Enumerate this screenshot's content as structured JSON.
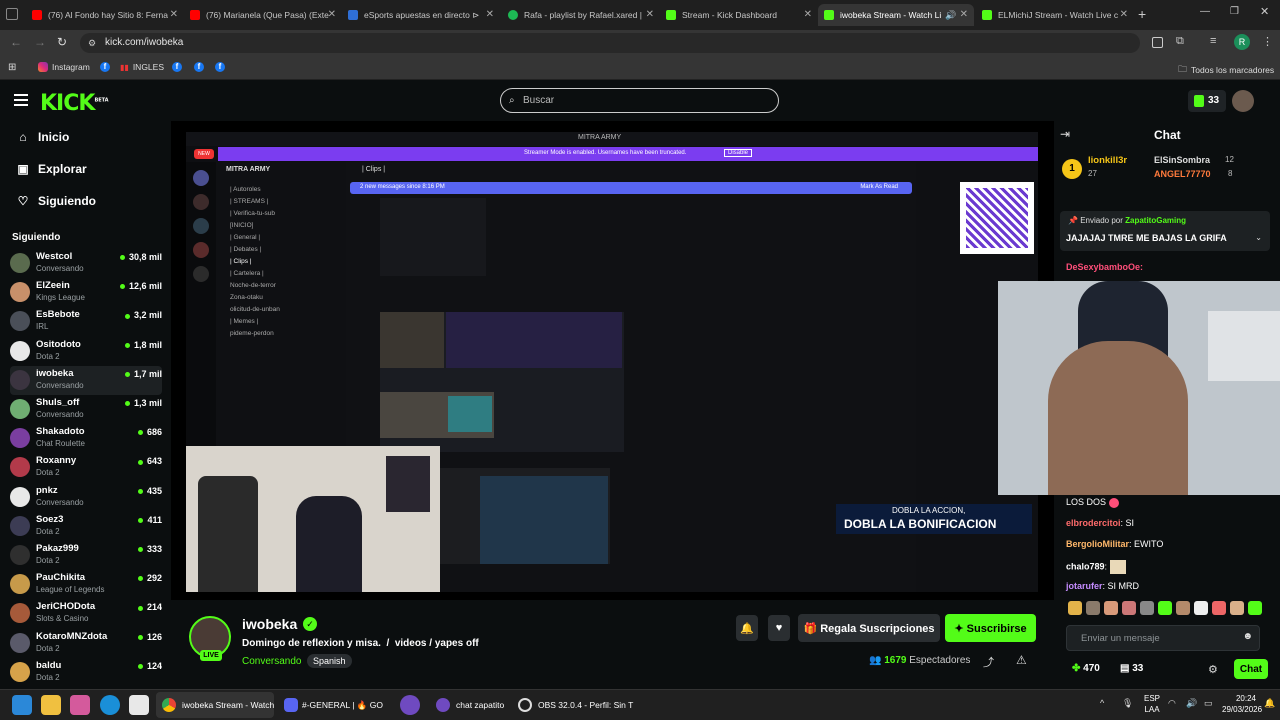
{
  "browser": {
    "tabs": [
      {
        "title": "(76) Al Fondo hay Sitio 8: Ferna",
        "color": "#ff0000"
      },
      {
        "title": "(76) Marianela (Que Pasa) (Exte",
        "color": "#ff0000"
      },
      {
        "title": "eSports apuestas en directo ⊳",
        "color": "#2f6fd6"
      },
      {
        "title": "Rafa - playlist by Rafael.xared |",
        "color": "#1db954"
      },
      {
        "title": "Stream - Kick Dashboard",
        "color": "#53fc18"
      },
      {
        "title": "iwobeka Stream - Watch Li",
        "color": "#53fc18"
      },
      {
        "title": "ELMichiJ Stream - Watch Live c",
        "color": "#53fc18"
      }
    ],
    "url": "kick.com/iwobeka",
    "bookmarks": {
      "instagram": "Instagram",
      "ingles": "INGLES",
      "all": "Todos los marcadores"
    }
  },
  "kick": {
    "logo": "KICK",
    "beta": "BETA",
    "search_placeholder": "Buscar",
    "kicks_count": "33",
    "nav": {
      "home": "Inicio",
      "browse": "Explorar",
      "following": "Siguiendo"
    },
    "following_heading": "Siguiendo",
    "following": [
      {
        "name": "Westcol",
        "game": "Conversando",
        "viewers": "30,8 mil",
        "color": "#5a6b4e"
      },
      {
        "name": "ElZeein",
        "game": "Kings League",
        "viewers": "12,6 mil",
        "color": "#c8906a"
      },
      {
        "name": "EsBebote",
        "game": "IRL",
        "viewers": "3,2 mil",
        "color": "#4a4f58"
      },
      {
        "name": "Ositodoto",
        "game": "Dota 2",
        "viewers": "1,8 mil",
        "color": "#e8e8e8"
      },
      {
        "name": "iwobeka",
        "game": "Conversando",
        "viewers": "1,7 mil",
        "color": "#3b3440"
      },
      {
        "name": "Shuls_off",
        "game": "Conversando",
        "viewers": "1,3 mil",
        "color": "#6fae72"
      },
      {
        "name": "Shakadoto",
        "game": "Chat Roulette",
        "viewers": "686",
        "color": "#7a3ea0"
      },
      {
        "name": "Roxanny",
        "game": "Dota 2",
        "viewers": "643",
        "color": "#b23a4a"
      },
      {
        "name": "pnkz",
        "game": "Conversando",
        "viewers": "435",
        "color": "#e8e8e8"
      },
      {
        "name": "Soez3",
        "game": "Dota 2",
        "viewers": "411",
        "color": "#3c3c54"
      },
      {
        "name": "Pakaz999",
        "game": "Dota 2",
        "viewers": "333",
        "color": "#2f2f2f"
      },
      {
        "name": "PauChikita",
        "game": "League of Legends",
        "viewers": "292",
        "color": "#c79a4a"
      },
      {
        "name": "JeriCHODota",
        "game": "Slots & Casino",
        "viewers": "214",
        "color": "#a65a3a"
      },
      {
        "name": "KotaroMNZdota",
        "game": "Dota 2",
        "viewers": "126",
        "color": "#5a5a6a"
      },
      {
        "name": "baldu",
        "game": "Dota 2",
        "viewers": "124",
        "color": "#d6a24a"
      }
    ],
    "stream": {
      "channel": "iwobeka",
      "live": "LIVE",
      "title": "Domingo de reflexion y misa.  /  videos / yapes off",
      "category": "Conversando",
      "tag": "Spanish",
      "gift_label": "Regala Suscripciones",
      "subscribe_label": "Suscribirse",
      "viewers": "1679",
      "viewers_label": "Espectadores"
    },
    "overlay": {
      "streamer_mode": "Streamer Mode is enabled. Usernames have been truncated.",
      "disable": "Disable",
      "server": "MITRA ARMY",
      "channel": "| Clips |",
      "new_messages": "2 new messages since 8:16 PM",
      "mark_read": "Mark As Read",
      "channels": [
        "| Autoroles",
        "| STREAMS |",
        "| Verifica-tu-sub",
        "[INICIO]",
        "| General |",
        "| Debates |",
        "| Clips |",
        "| Cartelera |",
        "Noche-de-terror",
        "Zona-otaku",
        "olicitud-de-unban",
        "| Memes |",
        "pideme-perdon"
      ],
      "badge_new": "NEW",
      "promo_small": "DOBLA LA ACCION,",
      "promo_big": "DOBLA LA BONIFICACION"
    },
    "chat": {
      "title": "Chat",
      "leaders": [
        {
          "name": "lionkill3r",
          "count": "27",
          "rank": "1"
        },
        {
          "name": "ElSinSombra",
          "count": "12"
        },
        {
          "name": "ANGEL77770",
          "count": "8"
        }
      ],
      "pinned_by_label": "Enviado por",
      "pinned_by": "ZapatitoGaming",
      "pinned_message": "JAJAJAJ TMRE ME BAJAS LA GRIFA",
      "top_user": "DeSexybamboOe:",
      "messages": [
        {
          "user": "",
          "text": "LOS DOS",
          "color": "#ffffff"
        },
        {
          "user": "elbrodercitoi",
          "text": "SI",
          "color": "#ff6b6b"
        },
        {
          "user": "BergolioMilitar",
          "text": "EWITO",
          "color": "#ffb86b"
        },
        {
          "user": "chalo789",
          "text": "",
          "color": "#ffffff"
        },
        {
          "user": "jotarufer",
          "text": "SI MRD",
          "color": "#c58cff"
        }
      ],
      "input_placeholder": "Enviar un mensaje",
      "points": "470",
      "kicks": "33",
      "send_label": "Chat"
    }
  },
  "taskbar": {
    "chrome_title": "iwobeka Stream - Watch",
    "discord_title": "#-GENERAL | 🔥 GO",
    "chat_title": "chat zapatito",
    "obs_title": "OBS 32.0.4 - Perfil: Sin T",
    "lang": "ESP",
    "layout": "LAA",
    "time": "20:24",
    "date": "29/03/2026"
  }
}
